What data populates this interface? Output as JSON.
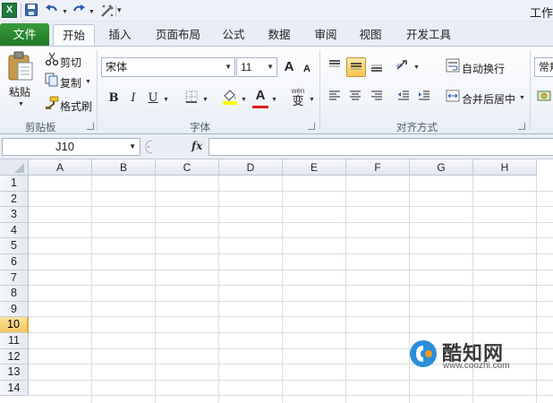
{
  "window": {
    "title": "工作"
  },
  "quick_access": {
    "logo": "X",
    "items": [
      "save-icon",
      "undo-icon",
      "redo-icon",
      "customize-icon"
    ]
  },
  "tabs": [
    {
      "label": "文件"
    },
    {
      "label": "开始"
    },
    {
      "label": "插入"
    },
    {
      "label": "页面布局"
    },
    {
      "label": "公式"
    },
    {
      "label": "数据"
    },
    {
      "label": "审阅"
    },
    {
      "label": "视图"
    },
    {
      "label": "开发工具"
    }
  ],
  "clipboard": {
    "paste_label": "粘贴",
    "cut_label": "剪切",
    "copy_label": "复制",
    "format_painter_label": "格式刷",
    "group_label": "剪贴板"
  },
  "font": {
    "name": "宋体",
    "size": "11",
    "bold_label": "B",
    "italic_label": "I",
    "underline_label": "U",
    "font_color_label": "A",
    "grow_label": "A",
    "shrink_label": "A",
    "wen_label": "wén",
    "wen_char": "变",
    "group_label": "字体"
  },
  "alignment": {
    "wrap_label": "自动换行",
    "merge_label": "合并后居中",
    "group_label": "对齐方式"
  },
  "number": {
    "format_label": "常规"
  },
  "formula_bar": {
    "name_box": "J10",
    "fx_label": "fx",
    "value": ""
  },
  "columns": [
    "A",
    "B",
    "C",
    "D",
    "E",
    "F",
    "G",
    "H"
  ],
  "rows": [
    "1",
    "2",
    "3",
    "4",
    "5",
    "6",
    "7",
    "8",
    "9",
    "10",
    "11",
    "12",
    "13",
    "14"
  ],
  "active_row": "10",
  "watermark": {
    "brand": "酷知网",
    "url": "www.coozhi.com"
  },
  "colors": {
    "file_tab": "#1f7a25",
    "accent_highlight": "#f7c64f",
    "gridline": "#dadcdd"
  }
}
